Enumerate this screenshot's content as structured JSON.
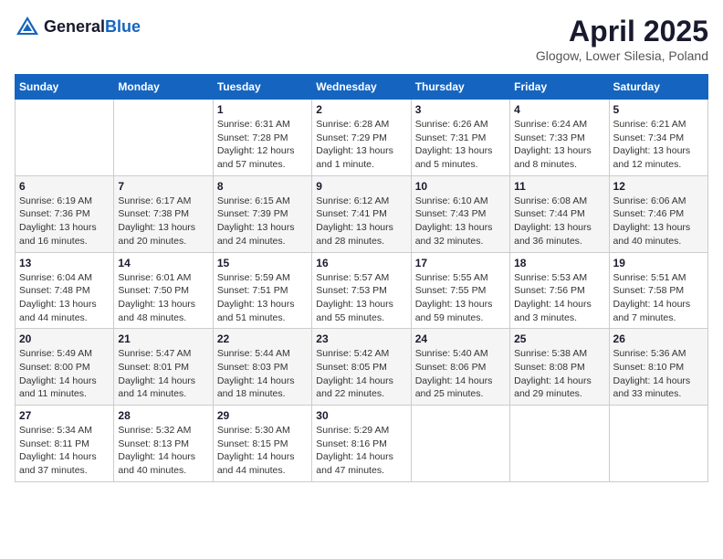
{
  "logo": {
    "general": "General",
    "blue": "Blue"
  },
  "header": {
    "month": "April 2025",
    "location": "Glogow, Lower Silesia, Poland"
  },
  "weekdays": [
    "Sunday",
    "Monday",
    "Tuesday",
    "Wednesday",
    "Thursday",
    "Friday",
    "Saturday"
  ],
  "weeks": [
    [
      {
        "day": "",
        "sunrise": "",
        "sunset": "",
        "daylight": ""
      },
      {
        "day": "",
        "sunrise": "",
        "sunset": "",
        "daylight": ""
      },
      {
        "day": "1",
        "sunrise": "Sunrise: 6:31 AM",
        "sunset": "Sunset: 7:28 PM",
        "daylight": "Daylight: 12 hours and 57 minutes."
      },
      {
        "day": "2",
        "sunrise": "Sunrise: 6:28 AM",
        "sunset": "Sunset: 7:29 PM",
        "daylight": "Daylight: 13 hours and 1 minute."
      },
      {
        "day": "3",
        "sunrise": "Sunrise: 6:26 AM",
        "sunset": "Sunset: 7:31 PM",
        "daylight": "Daylight: 13 hours and 5 minutes."
      },
      {
        "day": "4",
        "sunrise": "Sunrise: 6:24 AM",
        "sunset": "Sunset: 7:33 PM",
        "daylight": "Daylight: 13 hours and 8 minutes."
      },
      {
        "day": "5",
        "sunrise": "Sunrise: 6:21 AM",
        "sunset": "Sunset: 7:34 PM",
        "daylight": "Daylight: 13 hours and 12 minutes."
      }
    ],
    [
      {
        "day": "6",
        "sunrise": "Sunrise: 6:19 AM",
        "sunset": "Sunset: 7:36 PM",
        "daylight": "Daylight: 13 hours and 16 minutes."
      },
      {
        "day": "7",
        "sunrise": "Sunrise: 6:17 AM",
        "sunset": "Sunset: 7:38 PM",
        "daylight": "Daylight: 13 hours and 20 minutes."
      },
      {
        "day": "8",
        "sunrise": "Sunrise: 6:15 AM",
        "sunset": "Sunset: 7:39 PM",
        "daylight": "Daylight: 13 hours and 24 minutes."
      },
      {
        "day": "9",
        "sunrise": "Sunrise: 6:12 AM",
        "sunset": "Sunset: 7:41 PM",
        "daylight": "Daylight: 13 hours and 28 minutes."
      },
      {
        "day": "10",
        "sunrise": "Sunrise: 6:10 AM",
        "sunset": "Sunset: 7:43 PM",
        "daylight": "Daylight: 13 hours and 32 minutes."
      },
      {
        "day": "11",
        "sunrise": "Sunrise: 6:08 AM",
        "sunset": "Sunset: 7:44 PM",
        "daylight": "Daylight: 13 hours and 36 minutes."
      },
      {
        "day": "12",
        "sunrise": "Sunrise: 6:06 AM",
        "sunset": "Sunset: 7:46 PM",
        "daylight": "Daylight: 13 hours and 40 minutes."
      }
    ],
    [
      {
        "day": "13",
        "sunrise": "Sunrise: 6:04 AM",
        "sunset": "Sunset: 7:48 PM",
        "daylight": "Daylight: 13 hours and 44 minutes."
      },
      {
        "day": "14",
        "sunrise": "Sunrise: 6:01 AM",
        "sunset": "Sunset: 7:50 PM",
        "daylight": "Daylight: 13 hours and 48 minutes."
      },
      {
        "day": "15",
        "sunrise": "Sunrise: 5:59 AM",
        "sunset": "Sunset: 7:51 PM",
        "daylight": "Daylight: 13 hours and 51 minutes."
      },
      {
        "day": "16",
        "sunrise": "Sunrise: 5:57 AM",
        "sunset": "Sunset: 7:53 PM",
        "daylight": "Daylight: 13 hours and 55 minutes."
      },
      {
        "day": "17",
        "sunrise": "Sunrise: 5:55 AM",
        "sunset": "Sunset: 7:55 PM",
        "daylight": "Daylight: 13 hours and 59 minutes."
      },
      {
        "day": "18",
        "sunrise": "Sunrise: 5:53 AM",
        "sunset": "Sunset: 7:56 PM",
        "daylight": "Daylight: 14 hours and 3 minutes."
      },
      {
        "day": "19",
        "sunrise": "Sunrise: 5:51 AM",
        "sunset": "Sunset: 7:58 PM",
        "daylight": "Daylight: 14 hours and 7 minutes."
      }
    ],
    [
      {
        "day": "20",
        "sunrise": "Sunrise: 5:49 AM",
        "sunset": "Sunset: 8:00 PM",
        "daylight": "Daylight: 14 hours and 11 minutes."
      },
      {
        "day": "21",
        "sunrise": "Sunrise: 5:47 AM",
        "sunset": "Sunset: 8:01 PM",
        "daylight": "Daylight: 14 hours and 14 minutes."
      },
      {
        "day": "22",
        "sunrise": "Sunrise: 5:44 AM",
        "sunset": "Sunset: 8:03 PM",
        "daylight": "Daylight: 14 hours and 18 minutes."
      },
      {
        "day": "23",
        "sunrise": "Sunrise: 5:42 AM",
        "sunset": "Sunset: 8:05 PM",
        "daylight": "Daylight: 14 hours and 22 minutes."
      },
      {
        "day": "24",
        "sunrise": "Sunrise: 5:40 AM",
        "sunset": "Sunset: 8:06 PM",
        "daylight": "Daylight: 14 hours and 25 minutes."
      },
      {
        "day": "25",
        "sunrise": "Sunrise: 5:38 AM",
        "sunset": "Sunset: 8:08 PM",
        "daylight": "Daylight: 14 hours and 29 minutes."
      },
      {
        "day": "26",
        "sunrise": "Sunrise: 5:36 AM",
        "sunset": "Sunset: 8:10 PM",
        "daylight": "Daylight: 14 hours and 33 minutes."
      }
    ],
    [
      {
        "day": "27",
        "sunrise": "Sunrise: 5:34 AM",
        "sunset": "Sunset: 8:11 PM",
        "daylight": "Daylight: 14 hours and 37 minutes."
      },
      {
        "day": "28",
        "sunrise": "Sunrise: 5:32 AM",
        "sunset": "Sunset: 8:13 PM",
        "daylight": "Daylight: 14 hours and 40 minutes."
      },
      {
        "day": "29",
        "sunrise": "Sunrise: 5:30 AM",
        "sunset": "Sunset: 8:15 PM",
        "daylight": "Daylight: 14 hours and 44 minutes."
      },
      {
        "day": "30",
        "sunrise": "Sunrise: 5:29 AM",
        "sunset": "Sunset: 8:16 PM",
        "daylight": "Daylight: 14 hours and 47 minutes."
      },
      {
        "day": "",
        "sunrise": "",
        "sunset": "",
        "daylight": ""
      },
      {
        "day": "",
        "sunrise": "",
        "sunset": "",
        "daylight": ""
      },
      {
        "day": "",
        "sunrise": "",
        "sunset": "",
        "daylight": ""
      }
    ]
  ]
}
